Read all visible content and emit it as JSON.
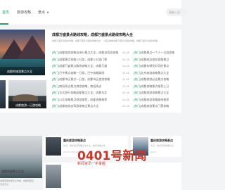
{
  "nav": {
    "items": [
      {
        "label": "首页",
        "active": true
      },
      {
        "label": "旅游攻略",
        "active": false
      },
      {
        "label": "景点",
        "active": false
      }
    ],
    "search_placeholder": "请输入关"
  },
  "featured": {
    "hero_caption": "成都的旅游景点大全",
    "thumb_caption": "成都旅游一日游攻略",
    "headline": "成都万盛景点路线攻略，成都万盛景点路线攻略大全",
    "summary": "成都万盛景点路线攻略，成都万盛景点路线攻略大全，一起来看看成都万盛景点路线攻略，成都万盛景点路线攻略……"
  },
  "news_left": [
    {
      "tag": "[热门]",
      "text": "成都旅游攻略自由行景点大全，成都自驾游攻略",
      "date": "03-05"
    },
    {
      "tag": "[热门]",
      "text": "成都景点攻略三日游，成都三日游门票",
      "date": "03-05"
    },
    {
      "tag": "[热门]",
      "text": "成都万盛景点路线攻略大全，成都万盛",
      "date": "03-05"
    },
    {
      "tag": "[热门]",
      "text": "巴中景点攻略一日游，巴中攻略路线",
      "date": "03-05"
    },
    {
      "tag": "[热门]",
      "text": "成都市区景点一日游，成都市区旅游攻略",
      "date": "03-05"
    },
    {
      "tag": "[热门]",
      "text": "南阳周边景点旅游攻略，南阳周边",
      "date": "03-05"
    },
    {
      "tag": "[热门]",
      "text": "东北旅行攻略成都景点大全，成都东北",
      "date": "03-05"
    },
    {
      "tag": "[热门]",
      "text": "川北攻略景点旅游推荐，成都攻略推荐",
      "date": "03-05"
    },
    {
      "tag": "[热门]",
      "text": "成都旅游自驾游攻略全景点大全",
      "date": "03-05"
    }
  ],
  "news_right": [
    {
      "tag": "[热门]",
      "text": "成都景点一个人一日游攻略"
    },
    {
      "tag": "[热门]",
      "text": "成都周边旅游攻略景点"
    },
    {
      "tag": "[热门]",
      "text": "成都有哪些好玩的景点"
    },
    {
      "tag": "[热门]",
      "text": "北京旅游攻略景点大全"
    },
    {
      "tag": "[热门]",
      "text": "成都旅游必去景点攻略"
    },
    {
      "tag": "[热门]",
      "text": "成都攻略景点推荐三日"
    },
    {
      "tag": "[热门]",
      "text": "成都旅游攻略景点大全"
    },
    {
      "tag": "[热门]",
      "text": "成都旅游攻略路线推荐"
    },
    {
      "tag": "[热门]",
      "text": "成都旅游景点门票攻略"
    }
  ],
  "section2": {
    "big_caption": "成都南部景点大全",
    "big_desc": "成都南部旅游景点攻略，成都南部自驾游景点",
    "card_a": {
      "title": "重庆旅游攻略景点",
      "desc": "景点，重庆旅游攻略景点大全，重庆攻略必去",
      "meta": "03-05  |  235人阅读"
    },
    "card_b": {
      "title": "重庆旅游攻略景点",
      "desc": "景点，重庆旅游攻略景点",
      "meta": "03-05"
    }
  },
  "watermark": {
    "main": "0401号新闻",
    "sub": "新闻资讯一手掌握"
  },
  "colors": {
    "accent": "#2a9d6a",
    "watermark": "#c53a2b"
  }
}
